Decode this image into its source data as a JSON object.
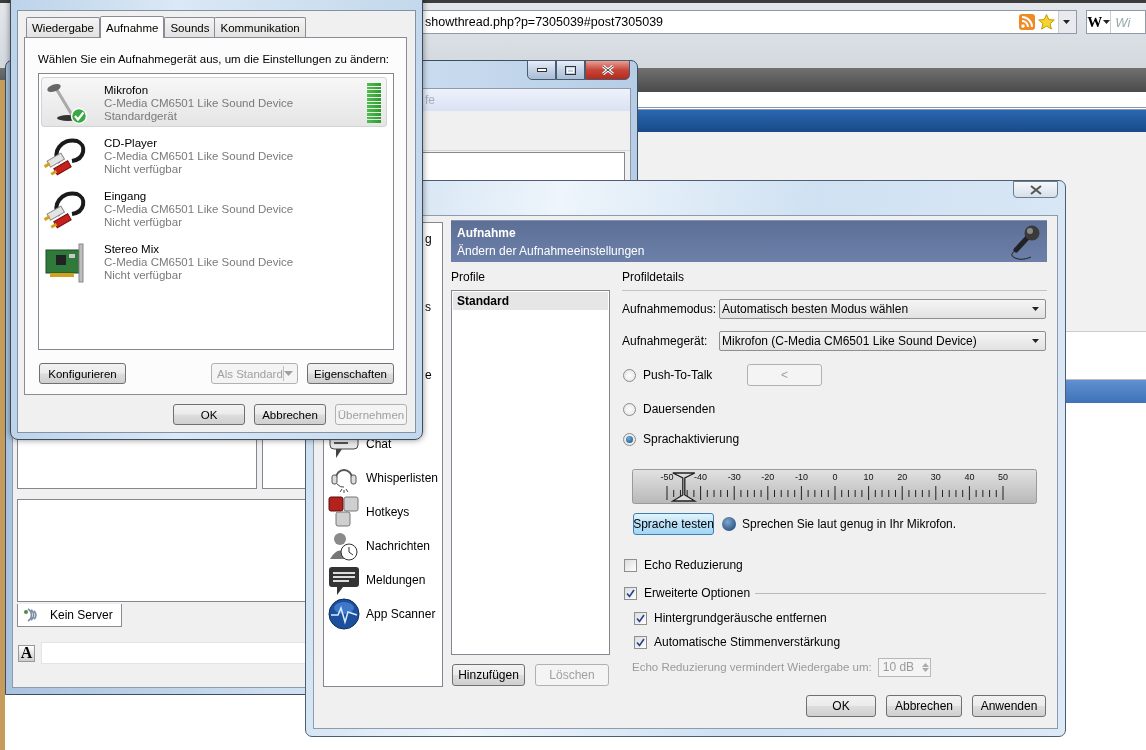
{
  "browser": {
    "address": "showthread.php?p=7305039#post7305039",
    "search": {
      "logo": "W",
      "placeholder": "Wi"
    }
  },
  "teamspeak_window": {
    "menu": [
      "fe"
    ],
    "tabs": [
      {
        "label": "Kein Server",
        "selected": true
      }
    ],
    "format_button": "A"
  },
  "settings_dialog": {
    "nav": [
      {
        "label": "g",
        "kind": "clipped"
      },
      {
        "label": "s",
        "kind": "clipped"
      },
      {
        "label": "e",
        "kind": "clipped"
      },
      {
        "label": "Chat",
        "kind": "item"
      },
      {
        "label": "Whisperlisten",
        "kind": "item"
      },
      {
        "label": "Hotkeys",
        "kind": "item"
      },
      {
        "label": "Nachrichten",
        "kind": "item"
      },
      {
        "label": "Meldungen",
        "kind": "item"
      },
      {
        "label": "App Scanner",
        "kind": "item"
      }
    ],
    "header": {
      "title": "Aufnahme",
      "subtitle": "Ändern der Aufnahmeeinstellungen"
    },
    "profiles": {
      "label": "Profile",
      "items": [
        {
          "label": "Standard",
          "selected": true
        }
      ],
      "buttons": [
        {
          "label": "Hinzufügen",
          "disabled": false
        },
        {
          "label": "Löschen",
          "disabled": true
        }
      ]
    },
    "details": {
      "label": "Profildetails",
      "fields": [
        {
          "label": "Aufnahmemodus:",
          "value": "Automatisch besten Modus wählen"
        },
        {
          "label": "Aufnahmegerät:",
          "value": "Mikrofon (C-Media CM6501 Like Sound Device)"
        }
      ],
      "modes": [
        {
          "label": "Push-To-Talk",
          "selected": false,
          "hotkey": {
            "label": "<",
            "disabled": true
          }
        },
        {
          "label": "Dauersenden",
          "selected": false
        },
        {
          "label": "Sprachaktivierung",
          "selected": true
        }
      ],
      "threshold": {
        "ticks": [
          "-50",
          "-40",
          "-30",
          "-20",
          "-10",
          "0",
          "10",
          "20",
          "30",
          "40",
          "50"
        ],
        "level": 0.05
      },
      "test_button": "Sprache testen",
      "test_hint": "Sprechen Sie laut genug in Ihr Mikrofon.",
      "options": [
        {
          "label": "Echo Reduzierung",
          "checked": false,
          "kind": "check"
        },
        {
          "label": "Erweiterte Optionen",
          "checked": true,
          "kind": "group"
        },
        {
          "label": "Hintergrundgeräusche entfernen",
          "checked": true,
          "kind": "sub"
        },
        {
          "label": "Automatische Stimmenverstärkung",
          "checked": true,
          "kind": "sub"
        }
      ],
      "echo_amount": {
        "label": "Echo Reduzierung vermindert Wiedergabe um:",
        "value": "10 dB",
        "disabled": true
      }
    },
    "buttons": [
      {
        "label": "OK",
        "disabled": false
      },
      {
        "label": "Abbrechen",
        "disabled": false
      },
      {
        "label": "Anwenden",
        "disabled": false
      }
    ]
  },
  "sound_dialog": {
    "tabs": [
      {
        "label": "Wiedergabe",
        "selected": false
      },
      {
        "label": "Aufnahme",
        "selected": true
      },
      {
        "label": "Sounds",
        "selected": false
      },
      {
        "label": "Kommunikation",
        "selected": false
      }
    ],
    "instruction": "Wählen Sie ein Aufnahmegerät aus, um die Einstellungen zu ändern:",
    "devices": [
      {
        "name": "Mikrofon",
        "driver": "C-Media CM6501 Like Sound Device",
        "status": "Standardgerät",
        "selected": true,
        "default": true,
        "level": 1
      },
      {
        "name": "CD-Player",
        "driver": "C-Media CM6501 Like Sound Device",
        "status": "Nicht verfügbar",
        "selected": false,
        "default": false
      },
      {
        "name": "Eingang",
        "driver": "C-Media CM6501 Like Sound Device",
        "status": "Nicht verfügbar",
        "selected": false,
        "default": false
      },
      {
        "name": "Stereo Mix",
        "driver": "C-Media CM6501 Like Sound Device",
        "status": "Nicht verfügbar",
        "selected": false,
        "default": false
      }
    ],
    "device_buttons": [
      {
        "label": "Konfigurieren",
        "disabled": false
      },
      {
        "label": "Als Standard",
        "disabled": true
      },
      {
        "label": "Eigenschaften",
        "disabled": false
      }
    ],
    "buttons": [
      {
        "label": "OK",
        "disabled": false
      },
      {
        "label": "Abbrechen",
        "disabled": false
      },
      {
        "label": "Übernehmen",
        "disabled": true
      }
    ]
  }
}
